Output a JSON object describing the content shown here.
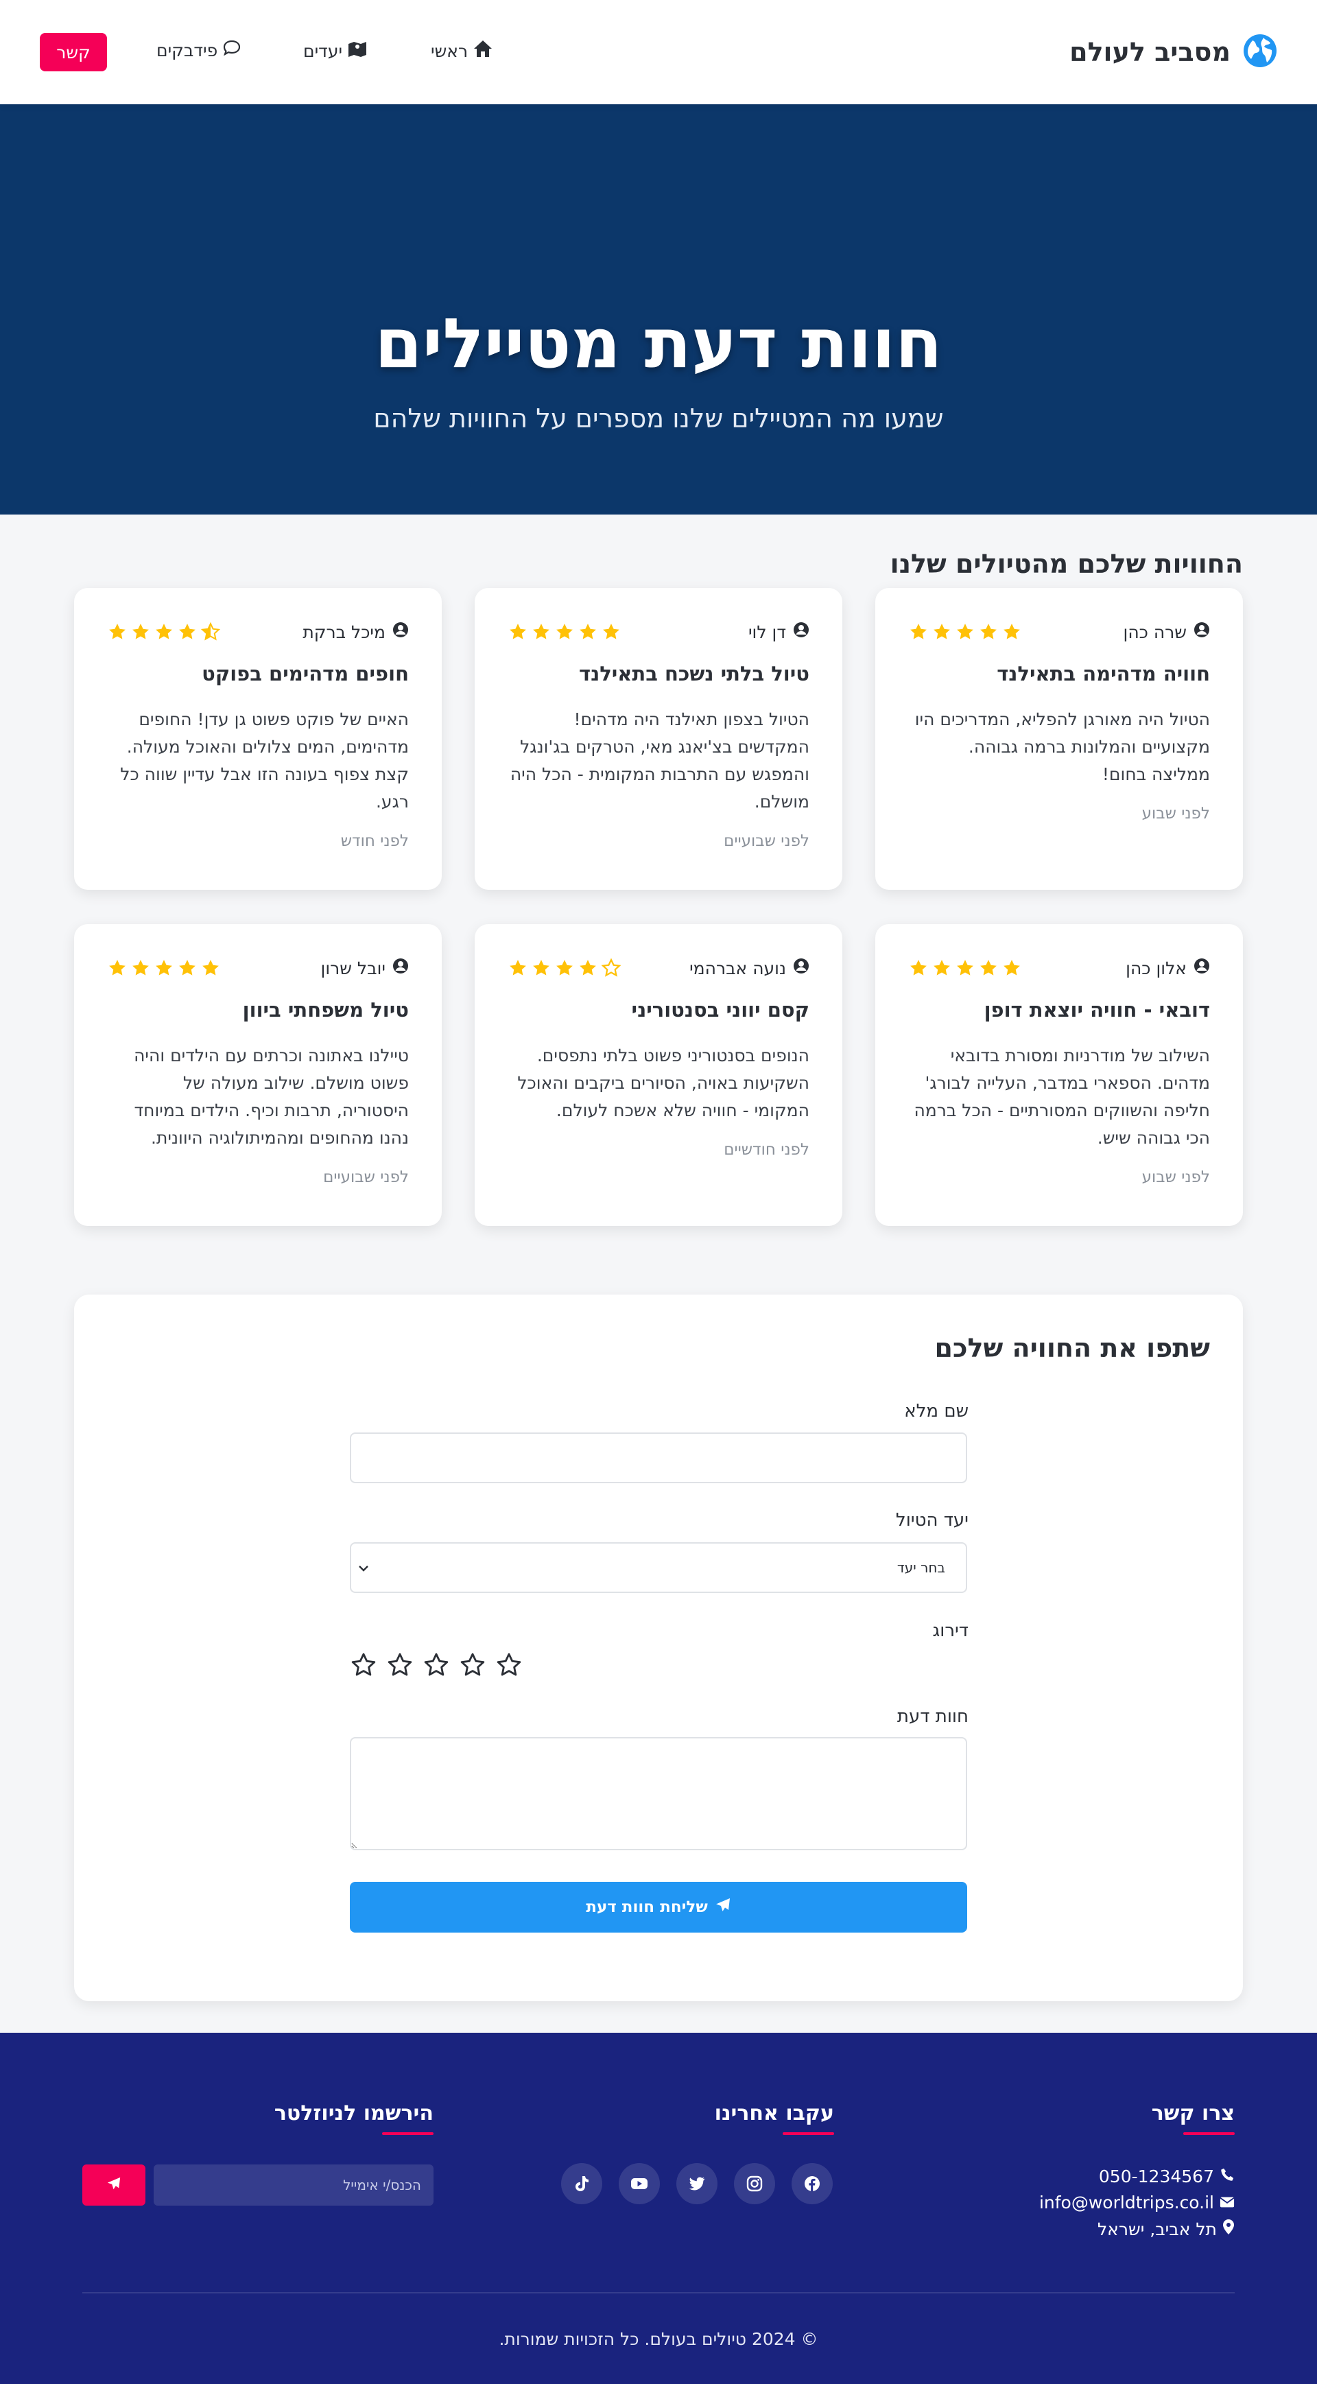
{
  "brand": {
    "name": "מסביב לעולם",
    "icon": "globe-icon"
  },
  "nav": {
    "home": "ראשי",
    "destinations": "יעדים",
    "feedback": "פידבקים",
    "contact": "קשר"
  },
  "hero": {
    "title": "חוות דעת מטיילים",
    "subtitle": "שמעו מה המטיילים שלנו מספרים על החוויות שלהם"
  },
  "reviews": {
    "section_title": "החוויות שלכם מהטיולים שלנו",
    "items": [
      {
        "name": "שרה כהן",
        "rating": 5,
        "title": "חוויה מדהימה בתאילנד",
        "text": "הטיול היה מאורגן להפליא, המדריכים היו מקצועיים והמלונות ברמה גבוהה. ממליצה בחום!",
        "time": "לפני שבוע"
      },
      {
        "name": "דן לוי",
        "rating": 5,
        "title": "טיול בלתי נשכח בתאילנד",
        "text": "הטיול בצפון תאילנד היה מדהים! המקדשים בצ'יאנג מאי, הטרקים בג'ונגל והמפגש עם התרבות המקומית - הכל היה מושלם.",
        "time": "לפני שבועיים"
      },
      {
        "name": "מיכל ברקת",
        "rating": 4.5,
        "title": "חופים מדהימים בפוקט",
        "text": "האיים של פוקט פשוט גן עדן! החופים מדהימים, המים צלולים והאוכל מעולה. קצת צפוף בעונה הזו אבל עדיין שווה כל רגע.",
        "time": "לפני חודש"
      },
      {
        "name": "אלון כהן",
        "rating": 5,
        "title": "דובאי - חוויה יוצאת דופן",
        "text": "השילוב של מודרניות ומסורת בדובאי מדהים. הספארי במדבר, העלייה לבורג' חליפה והשווקים המסורתיים - הכל ברמה הכי גבוהה שיש.",
        "time": "לפני שבוע"
      },
      {
        "name": "נועה אברהמי",
        "rating": 4,
        "title": "קסם יווני בסנטוריני",
        "text": "הנופים בסנטוריני פשוט בלתי נתפסים. השקיעות באויה, הסיורים ביקבים והאוכל המקומי - חוויה שלא אשכח לעולם.",
        "time": "לפני חודשיים"
      },
      {
        "name": "יובל שרון",
        "rating": 5,
        "title": "טיול משפחתי ביוון",
        "text": "טיילנו באתונה וכרתים עם הילדים והיה פשוט מושלם. שילוב מעולה של היסטוריה, תרבות וכיף. הילדים במיוחד נהנו מהחופים ומהמיתולוגיה היוונית.",
        "time": "לפני שבועיים"
      }
    ]
  },
  "form": {
    "title": "שתפו את החוויה שלכם",
    "name_label": "שם מלא",
    "name_value": "",
    "destination_label": "יעד הטיול",
    "destination_selected": "בחר יעד",
    "rating_label": "דירוג",
    "rating_value": 0,
    "review_label": "חוות דעת",
    "review_value": "",
    "submit_label": "שליחת חוות דעת"
  },
  "footer": {
    "contact_title": "צרו קשר",
    "phone": "050-1234567",
    "email": "info@worldtrips.co.il",
    "address": "תל אביב, ישראל",
    "follow_title": "עקבו אחרינו",
    "socials": [
      "facebook-icon",
      "instagram-icon",
      "twitter-icon",
      "youtube-icon",
      "tiktok-icon"
    ],
    "newsletter_title": "הירשמו לניוזלטר",
    "newsletter_placeholder": "הכנס/י אימייל",
    "copyright": "© 2024 טיולים בעולם. כל הזכויות שמורות."
  },
  "colors": {
    "navy": "#0c376a",
    "footer": "#1a237e",
    "accent": "#f50057",
    "primary": "#2196f3",
    "star": "#ffc107"
  }
}
